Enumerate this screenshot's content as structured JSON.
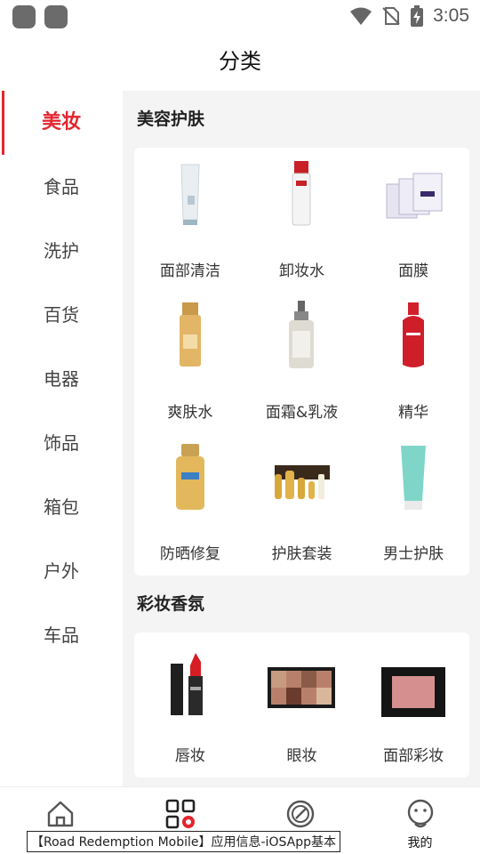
{
  "status_bar": {
    "time": "3:05"
  },
  "header": {
    "title": "分类"
  },
  "sidebar": {
    "items": [
      {
        "label": "美妆"
      },
      {
        "label": "食品"
      },
      {
        "label": "洗护"
      },
      {
        "label": "百货"
      },
      {
        "label": "电器"
      },
      {
        "label": "饰品"
      },
      {
        "label": "箱包"
      },
      {
        "label": "户外"
      },
      {
        "label": "车品"
      }
    ]
  },
  "sections": [
    {
      "title": "美容护肤",
      "items": [
        {
          "label": "面部清洁",
          "icon": "cleanser-tube-icon"
        },
        {
          "label": "卸妆水",
          "icon": "makeup-remover-bottle-icon"
        },
        {
          "label": "面膜",
          "icon": "face-mask-pack-icon"
        },
        {
          "label": "爽肤水",
          "icon": "toner-bottle-icon"
        },
        {
          "label": "面霜&乳液",
          "icon": "cream-pump-bottle-icon"
        },
        {
          "label": "精华",
          "icon": "serum-bottle-icon"
        },
        {
          "label": "防晒修复",
          "icon": "sunscreen-bottle-icon"
        },
        {
          "label": "护肤套装",
          "icon": "skincare-set-icon"
        },
        {
          "label": "男士护肤",
          "icon": "mens-tube-icon"
        }
      ]
    },
    {
      "title": "彩妆香氛",
      "items": [
        {
          "label": "唇妆",
          "icon": "lipstick-icon"
        },
        {
          "label": "眼妆",
          "icon": "eyeshadow-palette-icon"
        },
        {
          "label": "面部彩妆",
          "icon": "blush-compact-icon"
        }
      ]
    }
  ],
  "bottom_nav": {
    "items": [
      {
        "label": "",
        "icon": "home-icon"
      },
      {
        "label": "",
        "icon": "category-icon"
      },
      {
        "label": "",
        "icon": "discover-icon"
      },
      {
        "label": "我的",
        "icon": "profile-icon"
      }
    ]
  },
  "tooltip": {
    "text": "【Road Redemption Mobile】应用信息-iOSApp基本"
  },
  "colors": {
    "accent": "#e4252f",
    "content_bg": "#f4f4f4"
  }
}
